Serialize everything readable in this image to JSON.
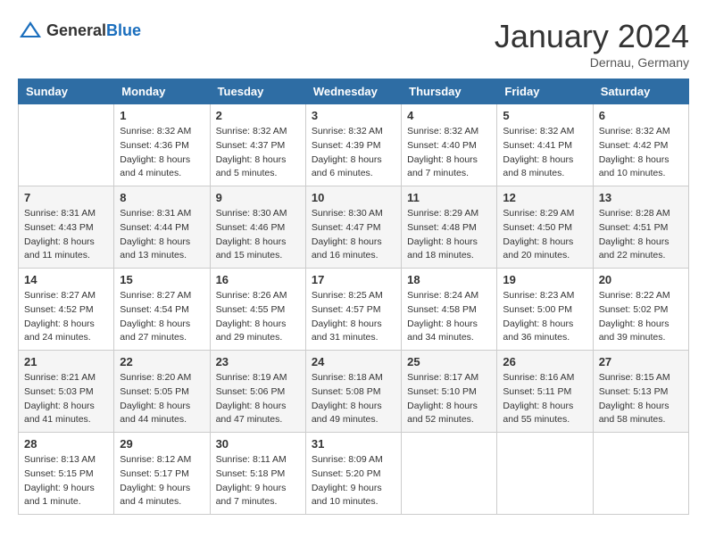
{
  "header": {
    "logo_general": "General",
    "logo_blue": "Blue",
    "month_title": "January 2024",
    "location": "Dernau, Germany"
  },
  "days_of_week": [
    "Sunday",
    "Monday",
    "Tuesday",
    "Wednesday",
    "Thursday",
    "Friday",
    "Saturday"
  ],
  "weeks": [
    [
      {
        "day": "",
        "sunrise": "",
        "sunset": "",
        "daylight": ""
      },
      {
        "day": "1",
        "sunrise": "Sunrise: 8:32 AM",
        "sunset": "Sunset: 4:36 PM",
        "daylight": "Daylight: 8 hours and 4 minutes."
      },
      {
        "day": "2",
        "sunrise": "Sunrise: 8:32 AM",
        "sunset": "Sunset: 4:37 PM",
        "daylight": "Daylight: 8 hours and 5 minutes."
      },
      {
        "day": "3",
        "sunrise": "Sunrise: 8:32 AM",
        "sunset": "Sunset: 4:39 PM",
        "daylight": "Daylight: 8 hours and 6 minutes."
      },
      {
        "day": "4",
        "sunrise": "Sunrise: 8:32 AM",
        "sunset": "Sunset: 4:40 PM",
        "daylight": "Daylight: 8 hours and 7 minutes."
      },
      {
        "day": "5",
        "sunrise": "Sunrise: 8:32 AM",
        "sunset": "Sunset: 4:41 PM",
        "daylight": "Daylight: 8 hours and 8 minutes."
      },
      {
        "day": "6",
        "sunrise": "Sunrise: 8:32 AM",
        "sunset": "Sunset: 4:42 PM",
        "daylight": "Daylight: 8 hours and 10 minutes."
      }
    ],
    [
      {
        "day": "7",
        "sunrise": "Sunrise: 8:31 AM",
        "sunset": "Sunset: 4:43 PM",
        "daylight": "Daylight: 8 hours and 11 minutes."
      },
      {
        "day": "8",
        "sunrise": "Sunrise: 8:31 AM",
        "sunset": "Sunset: 4:44 PM",
        "daylight": "Daylight: 8 hours and 13 minutes."
      },
      {
        "day": "9",
        "sunrise": "Sunrise: 8:30 AM",
        "sunset": "Sunset: 4:46 PM",
        "daylight": "Daylight: 8 hours and 15 minutes."
      },
      {
        "day": "10",
        "sunrise": "Sunrise: 8:30 AM",
        "sunset": "Sunset: 4:47 PM",
        "daylight": "Daylight: 8 hours and 16 minutes."
      },
      {
        "day": "11",
        "sunrise": "Sunrise: 8:29 AM",
        "sunset": "Sunset: 4:48 PM",
        "daylight": "Daylight: 8 hours and 18 minutes."
      },
      {
        "day": "12",
        "sunrise": "Sunrise: 8:29 AM",
        "sunset": "Sunset: 4:50 PM",
        "daylight": "Daylight: 8 hours and 20 minutes."
      },
      {
        "day": "13",
        "sunrise": "Sunrise: 8:28 AM",
        "sunset": "Sunset: 4:51 PM",
        "daylight": "Daylight: 8 hours and 22 minutes."
      }
    ],
    [
      {
        "day": "14",
        "sunrise": "Sunrise: 8:27 AM",
        "sunset": "Sunset: 4:52 PM",
        "daylight": "Daylight: 8 hours and 24 minutes."
      },
      {
        "day": "15",
        "sunrise": "Sunrise: 8:27 AM",
        "sunset": "Sunset: 4:54 PM",
        "daylight": "Daylight: 8 hours and 27 minutes."
      },
      {
        "day": "16",
        "sunrise": "Sunrise: 8:26 AM",
        "sunset": "Sunset: 4:55 PM",
        "daylight": "Daylight: 8 hours and 29 minutes."
      },
      {
        "day": "17",
        "sunrise": "Sunrise: 8:25 AM",
        "sunset": "Sunset: 4:57 PM",
        "daylight": "Daylight: 8 hours and 31 minutes."
      },
      {
        "day": "18",
        "sunrise": "Sunrise: 8:24 AM",
        "sunset": "Sunset: 4:58 PM",
        "daylight": "Daylight: 8 hours and 34 minutes."
      },
      {
        "day": "19",
        "sunrise": "Sunrise: 8:23 AM",
        "sunset": "Sunset: 5:00 PM",
        "daylight": "Daylight: 8 hours and 36 minutes."
      },
      {
        "day": "20",
        "sunrise": "Sunrise: 8:22 AM",
        "sunset": "Sunset: 5:02 PM",
        "daylight": "Daylight: 8 hours and 39 minutes."
      }
    ],
    [
      {
        "day": "21",
        "sunrise": "Sunrise: 8:21 AM",
        "sunset": "Sunset: 5:03 PM",
        "daylight": "Daylight: 8 hours and 41 minutes."
      },
      {
        "day": "22",
        "sunrise": "Sunrise: 8:20 AM",
        "sunset": "Sunset: 5:05 PM",
        "daylight": "Daylight: 8 hours and 44 minutes."
      },
      {
        "day": "23",
        "sunrise": "Sunrise: 8:19 AM",
        "sunset": "Sunset: 5:06 PM",
        "daylight": "Daylight: 8 hours and 47 minutes."
      },
      {
        "day": "24",
        "sunrise": "Sunrise: 8:18 AM",
        "sunset": "Sunset: 5:08 PM",
        "daylight": "Daylight: 8 hours and 49 minutes."
      },
      {
        "day": "25",
        "sunrise": "Sunrise: 8:17 AM",
        "sunset": "Sunset: 5:10 PM",
        "daylight": "Daylight: 8 hours and 52 minutes."
      },
      {
        "day": "26",
        "sunrise": "Sunrise: 8:16 AM",
        "sunset": "Sunset: 5:11 PM",
        "daylight": "Daylight: 8 hours and 55 minutes."
      },
      {
        "day": "27",
        "sunrise": "Sunrise: 8:15 AM",
        "sunset": "Sunset: 5:13 PM",
        "daylight": "Daylight: 8 hours and 58 minutes."
      }
    ],
    [
      {
        "day": "28",
        "sunrise": "Sunrise: 8:13 AM",
        "sunset": "Sunset: 5:15 PM",
        "daylight": "Daylight: 9 hours and 1 minute."
      },
      {
        "day": "29",
        "sunrise": "Sunrise: 8:12 AM",
        "sunset": "Sunset: 5:17 PM",
        "daylight": "Daylight: 9 hours and 4 minutes."
      },
      {
        "day": "30",
        "sunrise": "Sunrise: 8:11 AM",
        "sunset": "Sunset: 5:18 PM",
        "daylight": "Daylight: 9 hours and 7 minutes."
      },
      {
        "day": "31",
        "sunrise": "Sunrise: 8:09 AM",
        "sunset": "Sunset: 5:20 PM",
        "daylight": "Daylight: 9 hours and 10 minutes."
      },
      {
        "day": "",
        "sunrise": "",
        "sunset": "",
        "daylight": ""
      },
      {
        "day": "",
        "sunrise": "",
        "sunset": "",
        "daylight": ""
      },
      {
        "day": "",
        "sunrise": "",
        "sunset": "",
        "daylight": ""
      }
    ]
  ]
}
